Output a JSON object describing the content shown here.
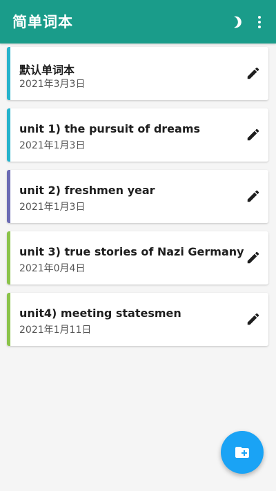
{
  "app": {
    "title": "简单词本",
    "accent_color": "#1a9c8a",
    "icons": {
      "theme_toggle": "moon-icon",
      "overflow_menu": "more-vert-icon",
      "edit": "pencil-icon",
      "add_folder": "create-new-folder-icon"
    }
  },
  "wordbooks": [
    {
      "title": "默认单词本",
      "date": "2021年3月3日",
      "stripe_color": "#26b3cc"
    },
    {
      "title": "unit 1) the pursuit of dreams",
      "date": "2021年1月3日",
      "stripe_color": "#26b3cc"
    },
    {
      "title": "unit 2) freshmen year",
      "date": "2021年1月3日",
      "stripe_color": "#6b6bb4"
    },
    {
      "title": "unit 3) true stories of Nazi Germany",
      "date": "2021年0月4日",
      "stripe_color": "#8bc34a"
    },
    {
      "title": "unit4) meeting statesmen",
      "date": "2021年1月11日",
      "stripe_color": "#8bc34a"
    }
  ],
  "fab": {
    "color": "#1aa3f5",
    "icon": "create-new-folder-icon"
  }
}
